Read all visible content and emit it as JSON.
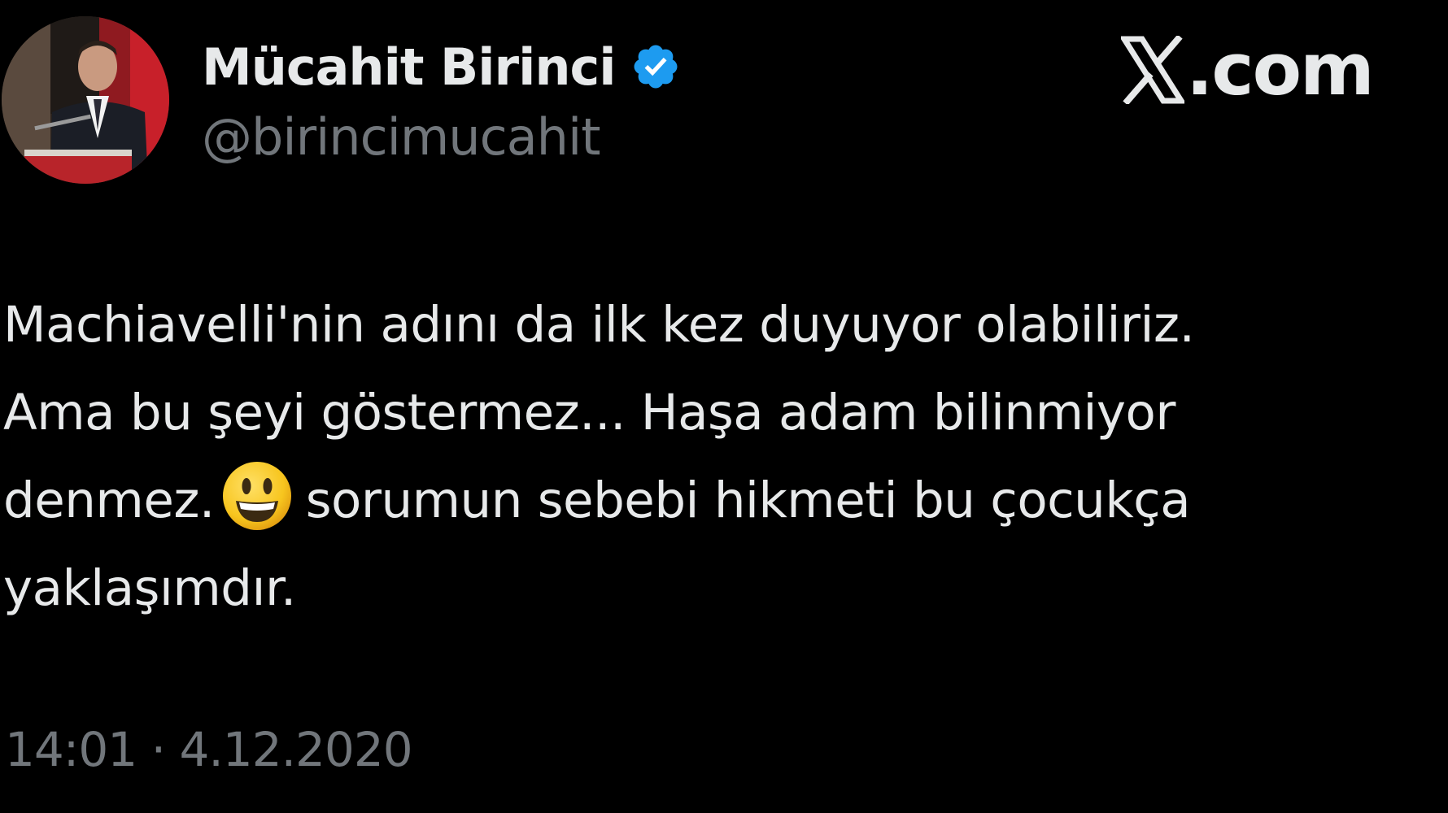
{
  "author": {
    "display_name": "Mücahit Birinci",
    "handle": "@birincimucahit",
    "verified_icon": "verified-badge-icon",
    "avatar_icon": "profile-photo"
  },
  "brand": {
    "icon": "x-logo-icon",
    "domain": ".com"
  },
  "tweet": {
    "lines": {
      "l1": "Machiavelli'nin adını da ilk kez duyuyor olabiliriz.",
      "l2": "Ama bu şeyi göstermez... Haşa adam bilinmiyor",
      "l3_before_emoji": "denmez.",
      "l3_after_emoji": "sorumun sebebi hikmeti bu çocukça",
      "l4": "yaklaşımdır."
    },
    "emoji_icon": "smiling-face-icon"
  },
  "meta": {
    "timestamp": "14:01 · 4.12.2020"
  },
  "colors": {
    "background": "#000000",
    "primary_text": "#e7e9ea",
    "secondary_text": "#71767b",
    "verified_blue": "#1d9bf0"
  }
}
